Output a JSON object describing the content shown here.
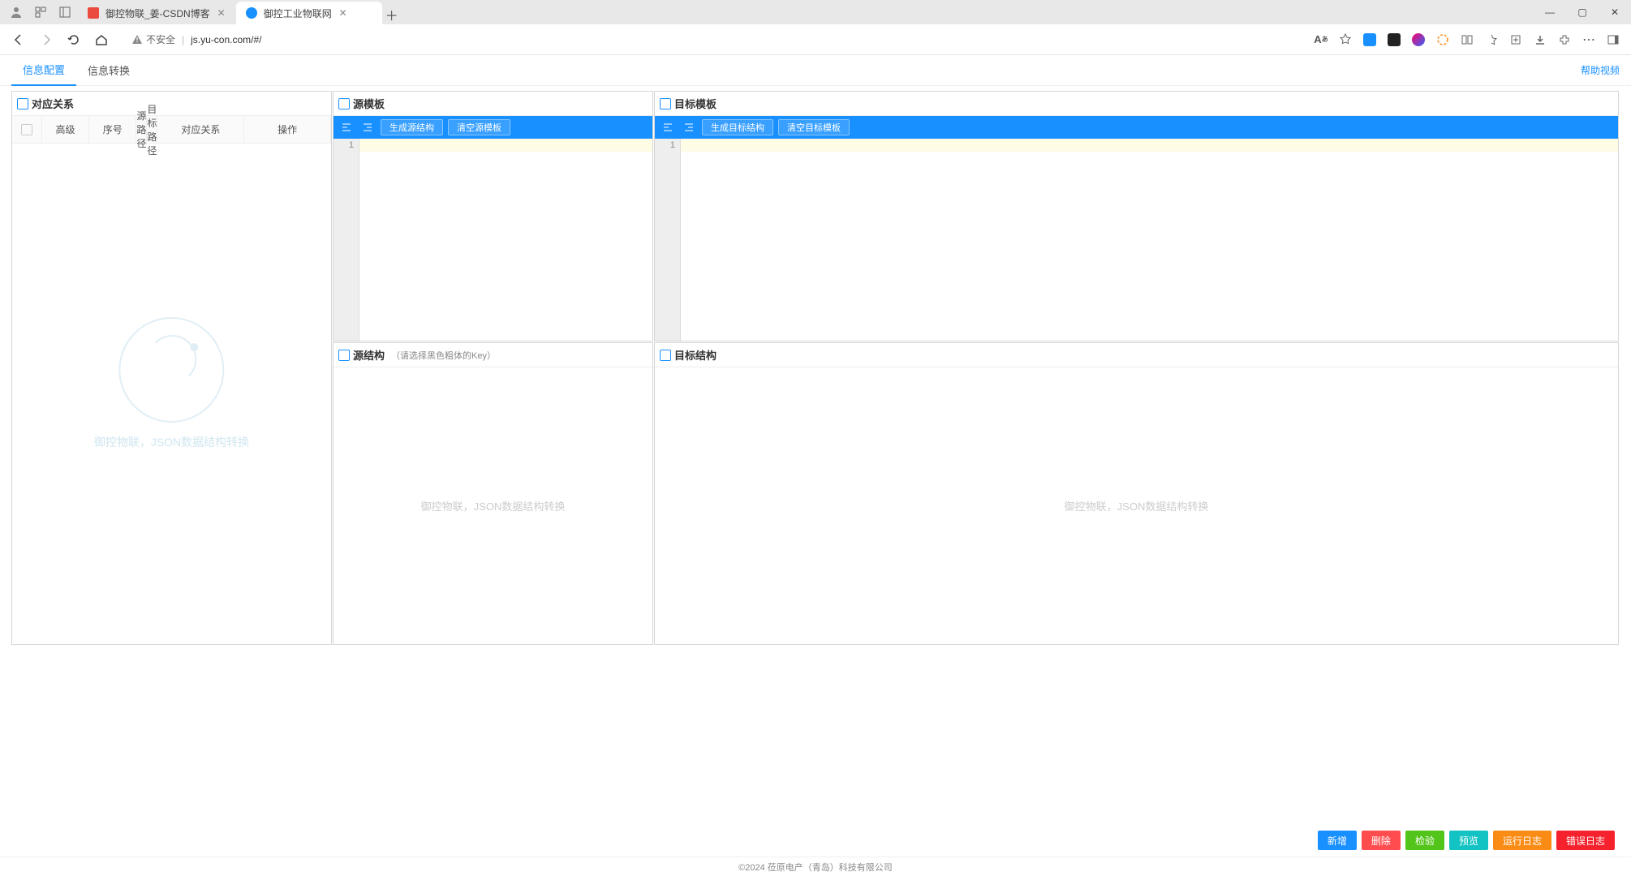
{
  "browser": {
    "tabs": [
      {
        "title": "御控物联_姜-CSDN博客",
        "active": false,
        "favicon_color": "#eb4b3e"
      },
      {
        "title": "御控工业物联网",
        "active": true,
        "favicon_color": "#1890ff"
      }
    ],
    "url_warning": "不安全",
    "url": "js.yu-con.com/#/",
    "win": {
      "min": "—",
      "max": "▢",
      "close": "✕"
    }
  },
  "app": {
    "tabs": [
      {
        "id": "config",
        "label": "信息配置",
        "active": true
      },
      {
        "id": "convert",
        "label": "信息转换",
        "active": false
      }
    ],
    "help_link": "帮助视频"
  },
  "panels": {
    "source_template": {
      "title": "源模板",
      "buttons": {
        "gen": "生成源结构",
        "clear": "清空源模板"
      },
      "line_num": "1"
    },
    "target_template": {
      "title": "目标模板",
      "buttons": {
        "gen": "生成目标结构",
        "clear": "清空目标模板"
      },
      "line_num": "1"
    },
    "source_struct": {
      "title": "源结构",
      "hint": "（请选择黑色粗体的Key）",
      "placeholder": "御控物联，JSON数据结构转换"
    },
    "target_struct": {
      "title": "目标结构",
      "placeholder": "御控物联，JSON数据结构转换"
    },
    "relation": {
      "title": "对应关系",
      "columns": {
        "advanced": "高级",
        "index": "序号",
        "src_path": "源路径",
        "dst_path": "目标路径",
        "relation": "对应关系",
        "action": "操作"
      },
      "watermark": "御控物联，JSON数据结构转换"
    }
  },
  "actions": {
    "add": "新增",
    "delete": "删除",
    "validate": "检验",
    "preview": "预览",
    "runlog": "运行日志",
    "errlog": "错误日志"
  },
  "footer": "©2024 莅原电产（青岛）科技有限公司",
  "icons": {
    "user": "user-icon",
    "workspace": "workspace-icon",
    "panel": "panel-icon",
    "back": "back-icon",
    "forward": "forward-icon",
    "refresh": "refresh-icon",
    "home": "home-icon",
    "warn": "warning-icon",
    "font": "font-size-icon",
    "star": "star-icon",
    "plus": "plus-icon",
    "close": "close-icon",
    "format_left": "format-left-icon",
    "format_right": "format-right-icon",
    "collapse": "collapse-icon",
    "download": "download-icon",
    "more": "more-icon",
    "side": "sidepanel-icon"
  }
}
